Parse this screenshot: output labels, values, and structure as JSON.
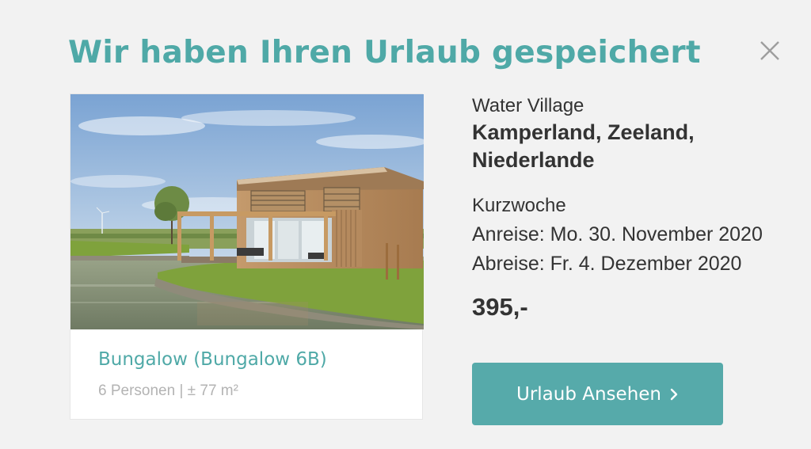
{
  "modal": {
    "title": "Wir haben Ihren Urlaub gespeichert",
    "close_icon": "close-icon"
  },
  "card": {
    "image": "holiday-bungalow-photo",
    "accommodation_name": "Bungalow (Bungalow 6B)",
    "details": "6 Personen | ± 77 m²"
  },
  "info": {
    "park": "Water Village",
    "location": "Kamperland, Zeeland, Niederlande",
    "stay_type": "Kurzwoche",
    "arrival": "Anreise: Mo. 30. November 2020",
    "departure": "Abreise: Fr. 4. Dezember 2020",
    "price": "395,-"
  },
  "cta": {
    "label": "Urlaub Ansehen",
    "icon": "chevron-right-icon"
  },
  "colors": {
    "accent": "#4fa9a7",
    "button": "#56aaaa",
    "background": "#f2f2f2",
    "text": "#333333",
    "muted": "#b3b3b3"
  }
}
